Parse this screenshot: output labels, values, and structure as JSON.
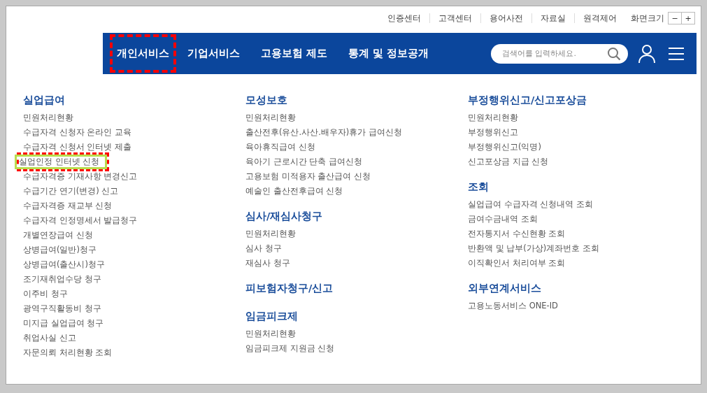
{
  "utility_links": [
    "인증센터",
    "고객센터",
    "용어사전",
    "자료실",
    "원격제어"
  ],
  "font_size": {
    "label": "화면크기",
    "buttons": [
      "−",
      "+"
    ]
  },
  "nav": [
    {
      "label": "개인서비스",
      "annotated": true
    },
    {
      "label": "기업서비스",
      "annotated": false
    },
    {
      "label": "고용보험 제도",
      "annotated": false
    },
    {
      "label": "통계 및 정보공개",
      "annotated": false
    }
  ],
  "search": {
    "placeholder": "검색어를 입력하세요."
  },
  "columns": [
    {
      "sections": [
        {
          "title": "실업급여",
          "items": [
            {
              "label": "민원처리현황",
              "highlighted": false
            },
            {
              "label": "수급자격 신청자 온라인 교육",
              "highlighted": false
            },
            {
              "label": "수급자격 신청서 인터넷 제출",
              "highlighted": false
            },
            {
              "label": "실업인정 인터넷 신청",
              "highlighted": true
            },
            {
              "label": "수급자격증 기재사항 변경신고",
              "highlighted": false
            },
            {
              "label": "수급기간 연기(변경) 신고",
              "highlighted": false
            },
            {
              "label": "수급자격증 재교부 신청",
              "highlighted": false
            },
            {
              "label": "수급자격 인정명세서 발급청구",
              "highlighted": false
            },
            {
              "label": "개별연장급여 신청",
              "highlighted": false
            },
            {
              "label": "상병급여(일반)청구",
              "highlighted": false
            },
            {
              "label": "상병급여(출산시)청구",
              "highlighted": false
            },
            {
              "label": "조기재취업수당 청구",
              "highlighted": false
            },
            {
              "label": "이주비 청구",
              "highlighted": false
            },
            {
              "label": "광역구직활동비 청구",
              "highlighted": false
            },
            {
              "label": "미지급 실업급여 청구",
              "highlighted": false
            },
            {
              "label": "취업사실 신고",
              "highlighted": false
            },
            {
              "label": "자문의뢰 처리현황 조회",
              "highlighted": false
            }
          ]
        }
      ]
    },
    {
      "sections": [
        {
          "title": "모성보호",
          "items": [
            {
              "label": "민원처리현황",
              "highlighted": false
            },
            {
              "label": "출산전후(유산.사산.배우자)휴가 급여신청",
              "highlighted": false
            },
            {
              "label": "육아휴직급여 신청",
              "highlighted": false
            },
            {
              "label": "육아기 근로시간 단축 급여신청",
              "highlighted": false
            },
            {
              "label": "고용보험 미적용자 출산급여 신청",
              "highlighted": false
            },
            {
              "label": "예술인 출산전후급여 신청",
              "highlighted": false
            }
          ]
        },
        {
          "title": "심사/재심사청구",
          "items": [
            {
              "label": "민원처리현황",
              "highlighted": false
            },
            {
              "label": "심사 청구",
              "highlighted": false
            },
            {
              "label": "재심사 청구",
              "highlighted": false
            }
          ]
        },
        {
          "title": "피보험자청구/신고"
        },
        {
          "title": "임금피크제",
          "items": [
            {
              "label": "민원처리현황",
              "highlighted": false
            },
            {
              "label": "임금피크제 지원금 신청",
              "highlighted": false
            }
          ]
        }
      ]
    },
    {
      "sections": [
        {
          "title": "부정행위신고/신고포상금",
          "items": [
            {
              "label": "민원처리현황",
              "highlighted": false
            },
            {
              "label": "부정행위신고",
              "highlighted": false
            },
            {
              "label": "부정행위신고(익명)",
              "highlighted": false
            },
            {
              "label": "신고포상금 지급 신청",
              "highlighted": false
            }
          ]
        },
        {
          "title": "조회",
          "items": [
            {
              "label": "실업급여 수급자격 신청내역 조회",
              "highlighted": false
            },
            {
              "label": "금여수금내역 조회",
              "highlighted": false
            },
            {
              "label": "전자통지서 수신현황 조회",
              "highlighted": false
            },
            {
              "label": "반환액 및 납부(가상)계좌번호 조회",
              "highlighted": false
            },
            {
              "label": "이직확인서 처리여부 조회",
              "highlighted": false
            }
          ]
        },
        {
          "title": "외부연계서비스",
          "items": [
            {
              "label": "고용노동서비스 ONE-ID",
              "highlighted": false
            }
          ]
        }
      ]
    }
  ]
}
